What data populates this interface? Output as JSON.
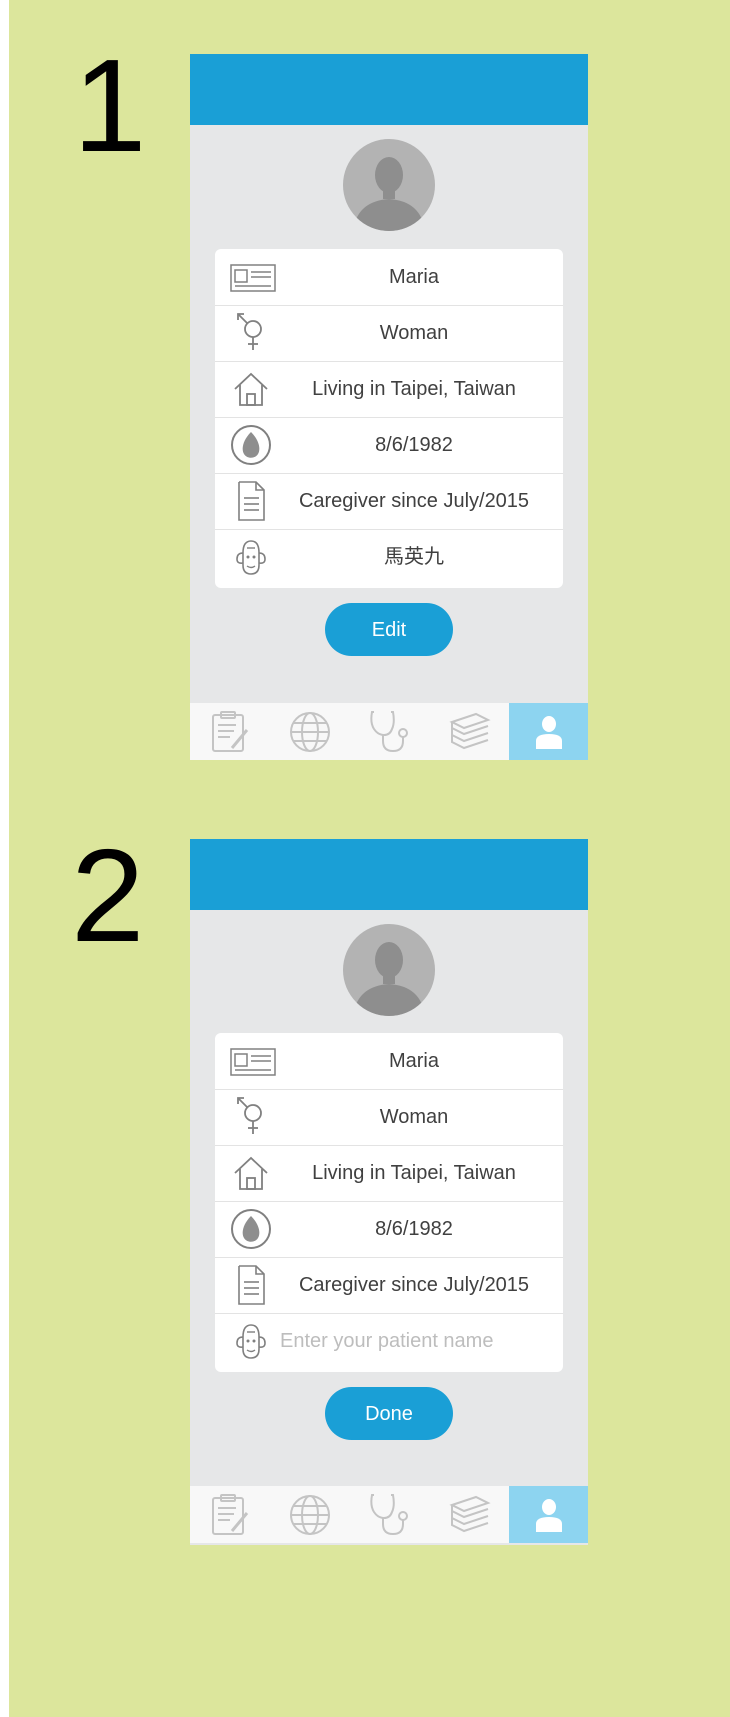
{
  "steps": [
    {
      "number": "1",
      "fields": {
        "name": "Maria",
        "gender": "Woman",
        "location": "Living in Taipei, Taiwan",
        "birthdate": "8/6/1982",
        "caregiver_since": "Caregiver since July/2015",
        "patient_name": "馬英九"
      },
      "button_label": "Edit"
    },
    {
      "number": "2",
      "fields": {
        "name": "Maria",
        "gender": "Woman",
        "location": "Living in Taipei, Taiwan",
        "birthdate": "8/6/1982",
        "caregiver_since": "Caregiver since July/2015",
        "patient_name_placeholder": "Enter your patient name"
      },
      "button_label": "Done"
    }
  ],
  "tabbar": {
    "items": [
      "notes-icon",
      "globe-icon",
      "stethoscope-icon",
      "books-icon",
      "profile-icon"
    ],
    "active": "profile-icon"
  },
  "colors": {
    "background": "#dce69c",
    "accent": "#1a9fd6",
    "active_tab": "#8dd4f0",
    "screen": "#e6e7e8"
  }
}
